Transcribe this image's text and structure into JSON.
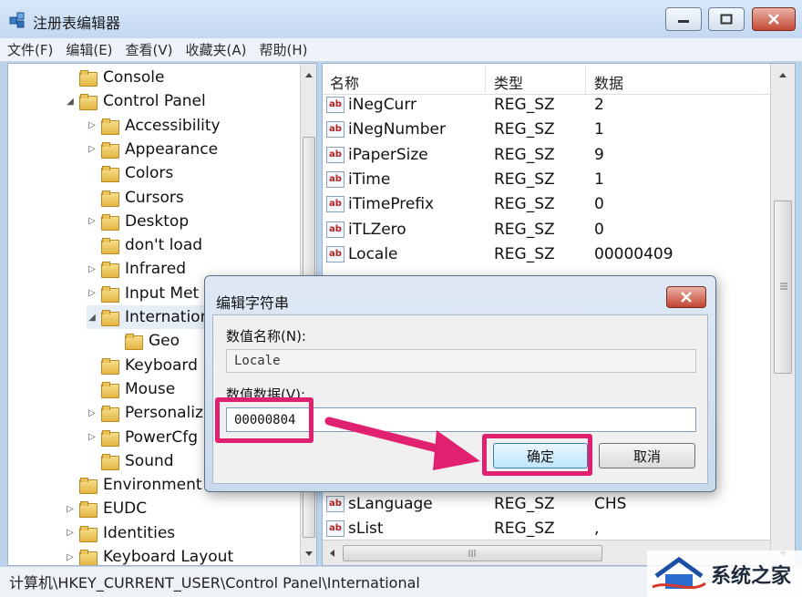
{
  "window": {
    "title": "注册表编辑器",
    "controls": {
      "minimize": "minimize",
      "maximize": "maximize",
      "close": "close"
    }
  },
  "menu": [
    "文件(F)",
    "编辑(E)",
    "查看(V)",
    "收藏夹(A)",
    "帮助(H)"
  ],
  "tree": {
    "items": [
      {
        "label": "Console",
        "arrow": "",
        "level": 1
      },
      {
        "label": "Control Panel",
        "arrow": "◢",
        "level": 1
      },
      {
        "label": "Accessibility",
        "arrow": "▷",
        "level": 2
      },
      {
        "label": "Appearance",
        "arrow": "▷",
        "level": 2
      },
      {
        "label": "Colors",
        "arrow": "",
        "level": 2
      },
      {
        "label": "Cursors",
        "arrow": "",
        "level": 2
      },
      {
        "label": "Desktop",
        "arrow": "▷",
        "level": 2
      },
      {
        "label": "don't load",
        "arrow": "",
        "level": 2
      },
      {
        "label": "Infrared",
        "arrow": "▷",
        "level": 2
      },
      {
        "label": "Input Met",
        "arrow": "▷",
        "level": 2
      },
      {
        "label": "Internation",
        "arrow": "◢",
        "level": 2
      },
      {
        "label": "Geo",
        "arrow": "",
        "level": 3
      },
      {
        "label": "Keyboard",
        "arrow": "",
        "level": 2
      },
      {
        "label": "Mouse",
        "arrow": "",
        "level": 2
      },
      {
        "label": "Personaliz",
        "arrow": "▷",
        "level": 2
      },
      {
        "label": "PowerCfg",
        "arrow": "▷",
        "level": 2
      },
      {
        "label": "Sound",
        "arrow": "",
        "level": 2
      },
      {
        "label": "Environment",
        "arrow": "",
        "level": 1
      },
      {
        "label": "EUDC",
        "arrow": "▷",
        "level": 1
      },
      {
        "label": "Identities",
        "arrow": "▷",
        "level": 1
      },
      {
        "label": "Keyboard Layout",
        "arrow": "▷",
        "level": 1
      }
    ]
  },
  "list": {
    "headers": {
      "name": "名称",
      "type": "类型",
      "data": "数据"
    },
    "rows": [
      {
        "name": "iNegCurr",
        "type": "REG_SZ",
        "data": "2"
      },
      {
        "name": "iNegNumber",
        "type": "REG_SZ",
        "data": "1"
      },
      {
        "name": "iPaperSize",
        "type": "REG_SZ",
        "data": "9"
      },
      {
        "name": "iTime",
        "type": "REG_SZ",
        "data": "1"
      },
      {
        "name": "iTimePrefix",
        "type": "REG_SZ",
        "data": "0"
      },
      {
        "name": "iTLZero",
        "type": "REG_SZ",
        "data": "0"
      },
      {
        "name": "Locale",
        "type": "REG_SZ",
        "data": "00000409"
      }
    ],
    "bottom_rows": [
      {
        "name": "sLanguage",
        "type": "REG_SZ",
        "data": "CHS"
      },
      {
        "name": "sList",
        "type": "REG_SZ",
        "data": ","
      }
    ],
    "icon_text": "ab"
  },
  "statusbar": {
    "path": "计算机\\HKEY_CURRENT_USER\\Control Panel\\International"
  },
  "watermark": {
    "text": "系统之家"
  },
  "dialog": {
    "title": "编辑字符串",
    "name_label": "数值名称(N):",
    "name_value": "Locale",
    "data_label": "数值数据(V):",
    "data_value": "00000804",
    "ok_label": "确定",
    "cancel_label": "取消"
  },
  "colors": {
    "highlight": "#e0216f",
    "folder": "#e3b542"
  }
}
